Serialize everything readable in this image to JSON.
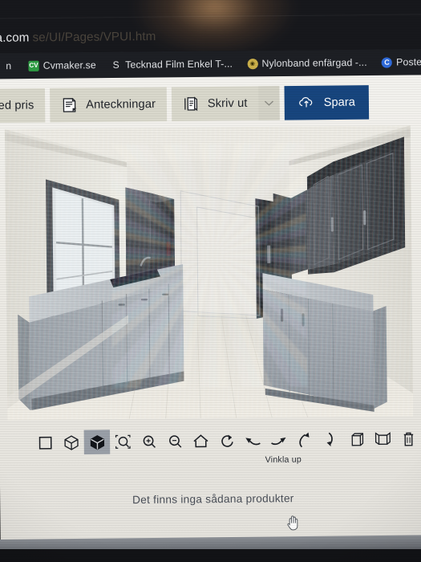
{
  "browser": {
    "url_visible": "a.com",
    "url_path_dim": "se/UI/Pages/VPUI.htm",
    "bookmarks": [
      {
        "label": "n",
        "icon": "page-icon",
        "icon_text": "n",
        "icon_class": "n"
      },
      {
        "label": "Cvmaker.se",
        "icon": "cvmaker-icon",
        "icon_text": "CV",
        "icon_class": "cv"
      },
      {
        "label": "Tecknad Film Enkel T-...",
        "icon": "letter-s-icon",
        "icon_text": "S",
        "icon_class": "s"
      },
      {
        "label": "Nylonband enfärgad -...",
        "icon": "gold-badge-icon",
        "icon_text": "◉",
        "icon_class": "ny"
      },
      {
        "label": "Posters kan du enkelt s...",
        "icon": "letter-c-circle-icon",
        "icon_text": "C",
        "icon_class": "c"
      }
    ]
  },
  "toolbar": {
    "price_button_label": "ned pris",
    "notes_button_label": "Anteckningar",
    "print_button_label": "Skriv ut",
    "print_caret_label": "⌄",
    "save_button_label": "Spara",
    "save_button_color": "#17457e",
    "button_bg_color": "#d9d8cc"
  },
  "viewer": {
    "tools": [
      {
        "name": "plan-2d-view-tool",
        "title": "2D"
      },
      {
        "name": "wireframe-3d-view-tool",
        "title": "3D wireframe"
      },
      {
        "name": "solid-3d-view-tool",
        "title": "3D solid",
        "selected": true
      },
      {
        "name": "zoom-to-fit-tool",
        "title": "Zoom to fit"
      },
      {
        "name": "zoom-in-tool",
        "title": "Zoom in"
      },
      {
        "name": "zoom-out-tool",
        "title": "Zoom out"
      },
      {
        "name": "home-view-tool",
        "title": "Home"
      },
      {
        "name": "rotate-tool",
        "title": "Rotate"
      },
      {
        "name": "rotate-left-tool",
        "title": "Rotate left"
      },
      {
        "name": "rotate-right-tool",
        "title": "Rotate right"
      },
      {
        "name": "tilt-up-tool",
        "title": "Vinkla up"
      },
      {
        "name": "tilt-down-tool",
        "title": "Vinkla ner"
      },
      {
        "name": "room-view-tool",
        "title": "Room view"
      },
      {
        "name": "open-room-view-tool",
        "title": "Open room view"
      },
      {
        "name": "delete-tool",
        "title": "Delete"
      }
    ],
    "tooltip_text": "Vinkla up",
    "canvas_bg": "#e9e7e0"
  },
  "content": {
    "empty_message": "Det finns inga sådana produkter"
  },
  "scene": {
    "description": "3D kitchen planner perspective view: galley kitchen with dark grey wall cabinets, light grey base cabinets, window on left wall, extractor hood, sink, tall units right",
    "wall_color": "#e6e4dd",
    "floor_color": "#ece9e1",
    "upper_cabinet_color": "#4a4d52",
    "base_cabinet_color": "#9ba2a9",
    "worktop_color": "#b9bec3"
  }
}
